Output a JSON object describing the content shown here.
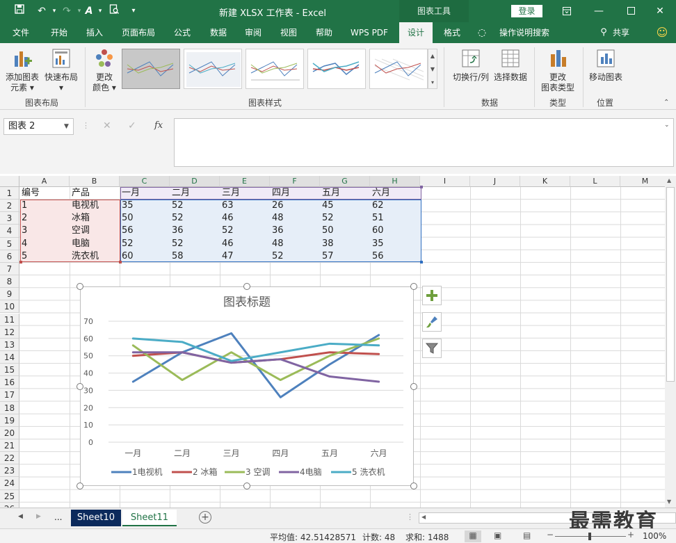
{
  "titlebar": {
    "title": "新建 XLSX 工作表 - Excel",
    "context_tab": "图表工具",
    "login": "登录"
  },
  "tabs": [
    "文件",
    "开始",
    "插入",
    "页面布局",
    "公式",
    "数据",
    "审阅",
    "视图",
    "帮助",
    "WPS PDF",
    "设计",
    "格式"
  ],
  "tell_me": "操作说明搜索",
  "share": "共享",
  "ribbon": {
    "add_element_l1": "添加图表",
    "add_element_l2": "元素",
    "quick_layout": "快速布局",
    "change_color_l1": "更改",
    "change_color_l2": "颜色",
    "group_layout": "图表布局",
    "group_styles": "图表样式",
    "switch_rowcol": "切换行/列",
    "select_data": "选择数据",
    "group_data": "数据",
    "change_type_l1": "更改",
    "change_type_l2": "图表类型",
    "group_type": "类型",
    "move_chart": "移动图表",
    "group_location": "位置"
  },
  "namebox": "图表 2",
  "columns": [
    "A",
    "B",
    "C",
    "D",
    "E",
    "F",
    "G",
    "H",
    "I",
    "J",
    "K",
    "L",
    "M"
  ],
  "rows": [
    "1",
    "2",
    "3",
    "4",
    "5",
    "6",
    "7",
    "8",
    "9",
    "10",
    "11",
    "12",
    "13",
    "14",
    "15",
    "16",
    "17",
    "18",
    "19",
    "20",
    "21",
    "22",
    "23",
    "24",
    "25",
    "26"
  ],
  "table": [
    [
      "编号",
      "产品",
      "一月",
      "二月",
      "三月",
      "四月",
      "五月",
      "六月"
    ],
    [
      "1",
      "电视机",
      "35",
      "52",
      "63",
      "26",
      "45",
      "62"
    ],
    [
      "2",
      "冰箱",
      "50",
      "52",
      "46",
      "48",
      "52",
      "51"
    ],
    [
      "3",
      "空调",
      "56",
      "36",
      "52",
      "36",
      "50",
      "60"
    ],
    [
      "4",
      "电脑",
      "52",
      "52",
      "46",
      "48",
      "38",
      "35"
    ],
    [
      "5",
      "洗衣机",
      "60",
      "58",
      "47",
      "52",
      "57",
      "56"
    ]
  ],
  "chart_data": {
    "type": "line",
    "title": "图表标题",
    "categories": [
      "一月",
      "二月",
      "三月",
      "四月",
      "五月",
      "六月"
    ],
    "ylim": [
      0,
      70
    ],
    "yticks": [
      "0",
      "10",
      "20",
      "30",
      "40",
      "50",
      "60",
      "70"
    ],
    "grid": true,
    "legend": "bottom",
    "series": [
      {
        "name": "1电视机",
        "values": [
          35,
          52,
          63,
          26,
          45,
          62
        ],
        "color": "#4e81bd"
      },
      {
        "name": "2 冰箱",
        "values": [
          50,
          52,
          46,
          48,
          52,
          51
        ],
        "color": "#c0504d"
      },
      {
        "name": "3 空调",
        "values": [
          56,
          36,
          52,
          36,
          50,
          60
        ],
        "color": "#9bbb59"
      },
      {
        "name": "4电脑",
        "values": [
          52,
          52,
          46,
          48,
          38,
          35
        ],
        "color": "#8064a2"
      },
      {
        "name": "5 洗衣机",
        "values": [
          60,
          58,
          47,
          52,
          57,
          56
        ],
        "color": "#4bacc6"
      }
    ]
  },
  "sheets": {
    "s1": "Sheet10",
    "s2": "Sheet11",
    "more": "..."
  },
  "status": {
    "average": "平均值: 42.51428571",
    "count": "计数: 48",
    "sum": "求和: 1488",
    "zoom": "100%"
  },
  "watermark": "最需教育",
  "colors": {
    "excel_green": "#217346",
    "chart_sel_purple": "#8064a2",
    "chart_sel_blue": "#2f6ec0"
  }
}
